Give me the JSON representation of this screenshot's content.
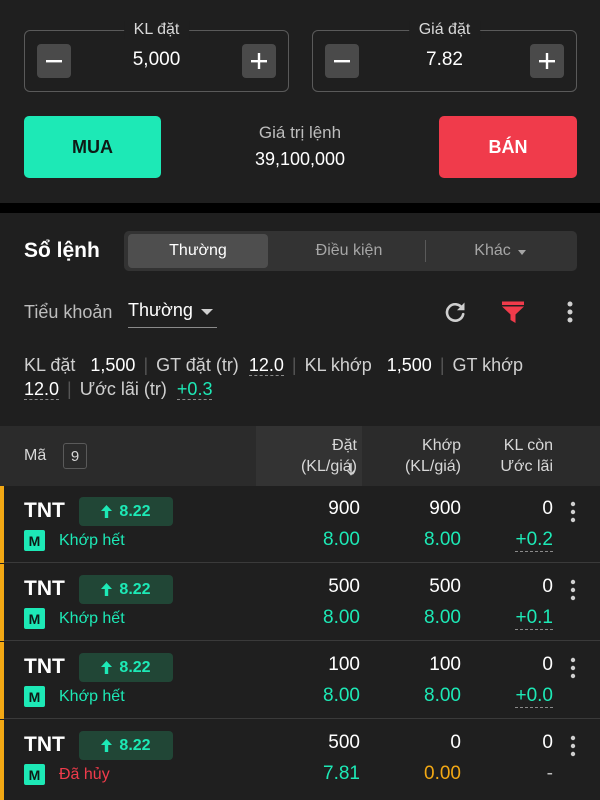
{
  "order_form": {
    "quantity": {
      "label": "KL đặt",
      "value": "5,000"
    },
    "price": {
      "label": "Giá đặt",
      "value": "7.82"
    },
    "buy_label": "MUA",
    "sell_label": "BÁN",
    "order_value_label": "Giá trị lệnh",
    "order_value": "39,100,000"
  },
  "order_book": {
    "title": "Sổ lệnh",
    "tabs": [
      {
        "label": "Thường",
        "active": true
      },
      {
        "label": "Điều kiện",
        "active": false
      },
      {
        "label": "Khác",
        "active": false
      }
    ],
    "sub_account_label": "Tiểu khoản",
    "sub_account_value": "Thường",
    "summary": {
      "kl_dat_label": "KL đặt",
      "kl_dat": "1,500",
      "gt_dat_label": "GT đặt (tr)",
      "gt_dat": "12.0",
      "kl_khop_label": "KL khớp",
      "kl_khop": "1,500",
      "gt_khop_label": "GT khớp",
      "gt_khop": "12.0",
      "uoc_lai_label": "Ước lãi (tr)",
      "uoc_lai": "+0.3"
    },
    "table": {
      "col_symbol": "Mã",
      "row_count": "9",
      "col_order_line1": "Đặt",
      "col_order_line2": "(KL/giá)",
      "col_match_line1": "Khớp",
      "col_match_line2": "(KL/giá)",
      "col_remain_line1": "KL còn",
      "col_remain_line2": "Ước lãi",
      "rows": [
        {
          "symbol": "TNT",
          "ref_price": "8.22",
          "market": "M",
          "status": "Khớp hết",
          "status_type": "matched",
          "order_qty": "900",
          "order_price": "8.00",
          "match_qty": "900",
          "match_price": "8.00",
          "remain_qty": "0",
          "est_profit": "+0.2"
        },
        {
          "symbol": "TNT",
          "ref_price": "8.22",
          "market": "M",
          "status": "Khớp hết",
          "status_type": "matched",
          "order_qty": "500",
          "order_price": "8.00",
          "match_qty": "500",
          "match_price": "8.00",
          "remain_qty": "0",
          "est_profit": "+0.1"
        },
        {
          "symbol": "TNT",
          "ref_price": "8.22",
          "market": "M",
          "status": "Khớp hết",
          "status_type": "matched",
          "order_qty": "100",
          "order_price": "8.00",
          "match_qty": "100",
          "match_price": "8.00",
          "remain_qty": "0",
          "est_profit": "+0.0"
        },
        {
          "symbol": "TNT",
          "ref_price": "8.22",
          "market": "M",
          "status": "Đã hủy",
          "status_type": "cancelled",
          "order_qty": "500",
          "order_price": "7.81",
          "match_qty": "0",
          "match_price": "0.00",
          "remain_qty": "0",
          "est_profit": "-"
        }
      ]
    }
  },
  "colors": {
    "buy": "#1de9b6",
    "sell": "#f03b4b",
    "accent_bar": "#f2a814",
    "filter_icon": "#f03b4b"
  },
  "icons": [
    "minus-icon",
    "plus-icon",
    "refresh-icon",
    "filter-icon",
    "more-vert-icon",
    "arrow-up-icon",
    "sort-down-icon",
    "chevron-down-icon"
  ]
}
